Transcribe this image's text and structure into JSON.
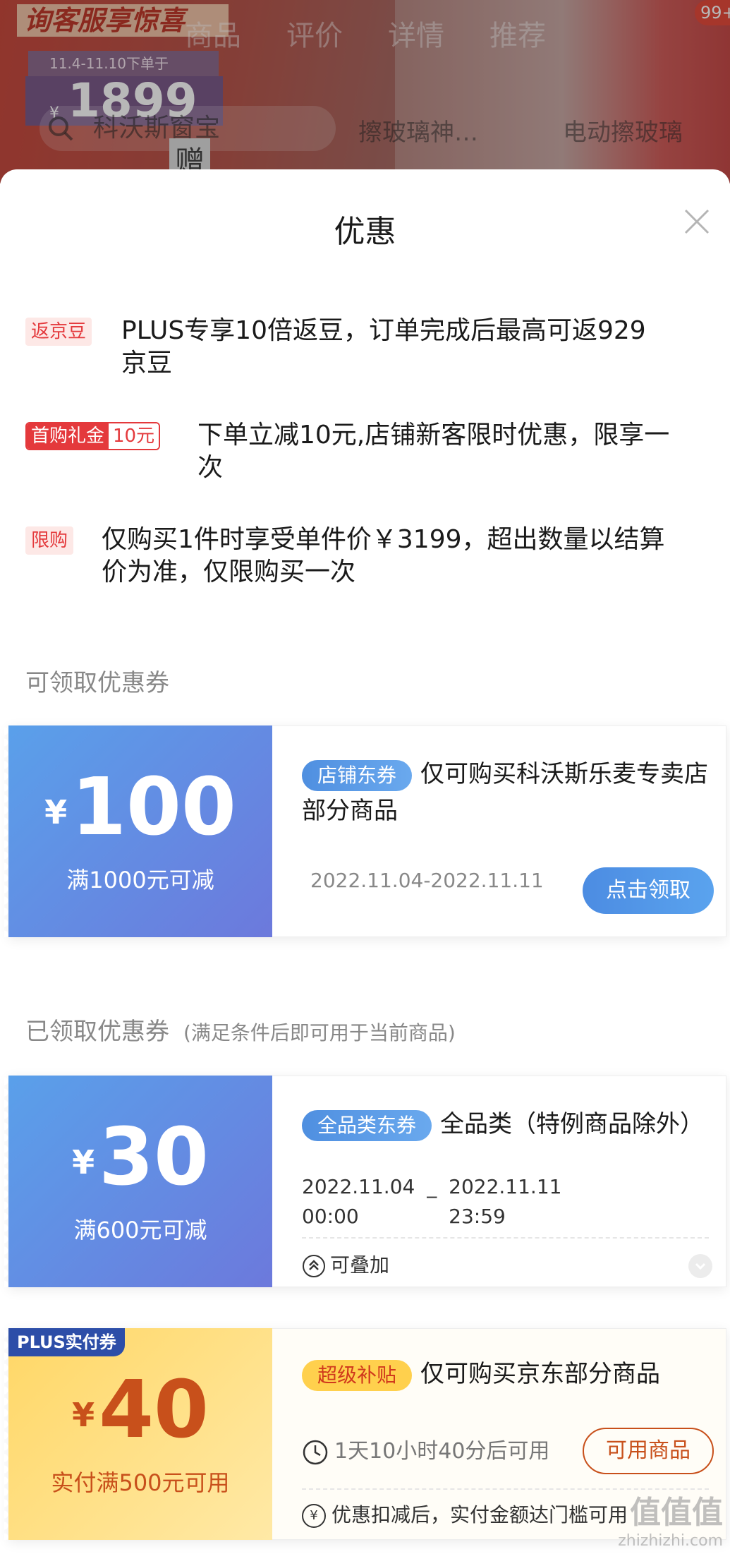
{
  "background": {
    "promo_banner": "询客服享惊喜",
    "promo_dates": "11.4-11.10下单于",
    "price_symbol": "¥",
    "price": "1899",
    "tabs": [
      "商品",
      "评价",
      "详情",
      "推荐"
    ],
    "search_text": "科沃斯窗宝",
    "keywords": [
      "擦玻璃神…",
      "电动擦玻璃"
    ],
    "gift": "赠",
    "cart_badge": "99+"
  },
  "sheet": {
    "title": "优惠"
  },
  "promotions": [
    {
      "tag": "返京豆",
      "text_line1": "PLUS专享10倍返豆，订单完成后最高可返929",
      "text_line2": "京豆"
    },
    {
      "tag_left": "首购礼金",
      "tag_right": "10元",
      "text_line1": "下单立减10元,店铺新客限时优惠，限享一",
      "text_line2": "次"
    },
    {
      "tag": "限购",
      "text_line1": "仅购买1件时享受单件价￥3199，超出数量以结算",
      "text_line2": "价为准，仅限购买一次"
    }
  ],
  "available_section": {
    "title": "可领取优惠券"
  },
  "available_coupon": {
    "symbol": "¥",
    "amount": "100",
    "condition": "满1000元可减",
    "tag": "店铺东券",
    "title": "仅可购买科沃斯乐麦专卖店部分商品",
    "date": "2022.11.04-2022.11.11",
    "button": "点击领取"
  },
  "claimed_section": {
    "title": "已领取优惠券",
    "subtitle": "(满足条件后即可用于当前商品)"
  },
  "claimed_coupon_1": {
    "symbol": "¥",
    "amount": "30",
    "condition": "满600元可减",
    "tag": "全品类东券",
    "title": "全品类（特例商品除外）",
    "start_date": "2022.11.04",
    "start_time": "00:00",
    "separator": "_",
    "end_date": "2022.11.11",
    "end_time": "23:59",
    "stack_label": "可叠加"
  },
  "claimed_coupon_2": {
    "badge": "PLUS实付券",
    "symbol": "¥",
    "amount": "40",
    "condition": "实付满500元可用",
    "tag": "超级补贴",
    "title": "仅可购买京东部分商品",
    "timer": "1天10小时40分后可用",
    "button": "可用商品",
    "note": "优惠扣减后，实付金额达门槛可用"
  },
  "watermark": {
    "logo": "值值值",
    "site": "zhizhizhi.com"
  },
  "colors": {
    "red": "#e4393c",
    "blue": "#5a9fea",
    "gold": "#ffd766"
  }
}
